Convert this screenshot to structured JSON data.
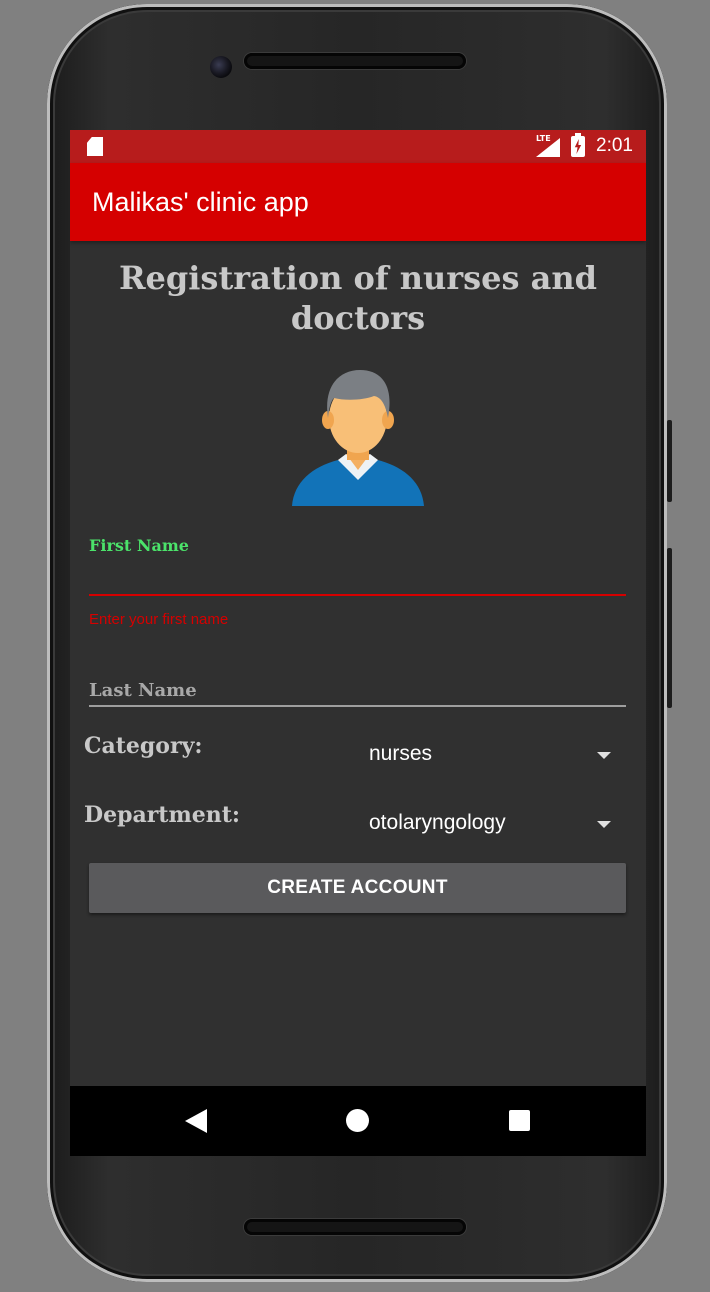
{
  "status_bar": {
    "time": "2:01",
    "network": "LTE",
    "icons": [
      "sd-card-icon",
      "signal-icon",
      "battery-charging-icon"
    ]
  },
  "app_bar": {
    "title": "Malikas' clinic app"
  },
  "page": {
    "title": "Registration of nurses and doctors",
    "avatar_icon": "person-avatar-icon"
  },
  "form": {
    "first_name": {
      "label": "First Name",
      "value": "",
      "error": "Enter your first name"
    },
    "last_name": {
      "placeholder": "Last Name",
      "value": ""
    },
    "category": {
      "label": "Category:",
      "selected": "nurses"
    },
    "department": {
      "label": "Department:",
      "selected": "otolaryngology"
    },
    "submit_label": "CREATE ACCOUNT"
  },
  "nav_bar": {
    "icons": [
      "back-icon",
      "home-icon",
      "recents-icon"
    ]
  },
  "colors": {
    "status_bar": "#b71c1c",
    "app_bar": "#d50000",
    "background": "#303030",
    "float_label": "#4be36a",
    "error": "#d50000",
    "button": "#5a5a5c"
  }
}
